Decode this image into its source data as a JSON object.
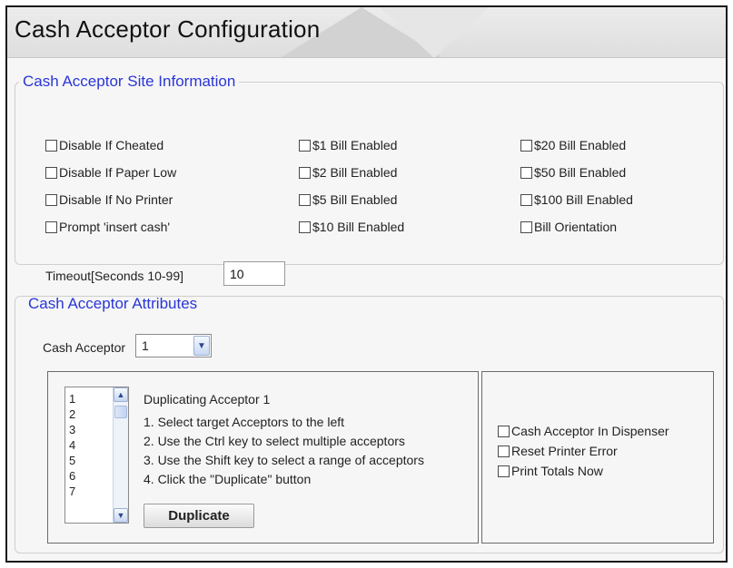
{
  "window": {
    "title": "Cash Acceptor Configuration"
  },
  "site_info": {
    "legend": "Cash Acceptor Site Information",
    "checkboxes": [
      [
        "Disable If Cheated",
        "Disable If Paper Low",
        "Disable If No Printer",
        "Prompt 'insert cash'"
      ],
      [
        "$1 Bill Enabled",
        "$2 Bill Enabled",
        "$5 Bill Enabled",
        "$10 Bill Enabled"
      ],
      [
        "$20 Bill Enabled",
        "$50 Bill Enabled",
        "$100 Bill Enabled",
        "Bill Orientation"
      ]
    ],
    "timeout_label": "Timeout[Seconds 10-99]",
    "timeout_value": "10"
  },
  "attributes": {
    "legend": "Cash Acceptor Attributes",
    "acceptor_label": "Cash Acceptor",
    "acceptor_selected": "1",
    "list_items": [
      "1",
      "2",
      "3",
      "4",
      "5",
      "6",
      "7"
    ],
    "duplicating_title": "Duplicating Acceptor 1",
    "instructions": [
      "1. Select target Acceptors to the left",
      "2. Use the Ctrl key to select multiple acceptors",
      "3. Use the Shift key to select a range of acceptors",
      "4. Click the \"Duplicate\" button"
    ],
    "duplicate_button": "Duplicate",
    "right_checkboxes": [
      "Cash Acceptor In Dispenser",
      "Reset Printer Error",
      "Print Totals Now"
    ]
  }
}
